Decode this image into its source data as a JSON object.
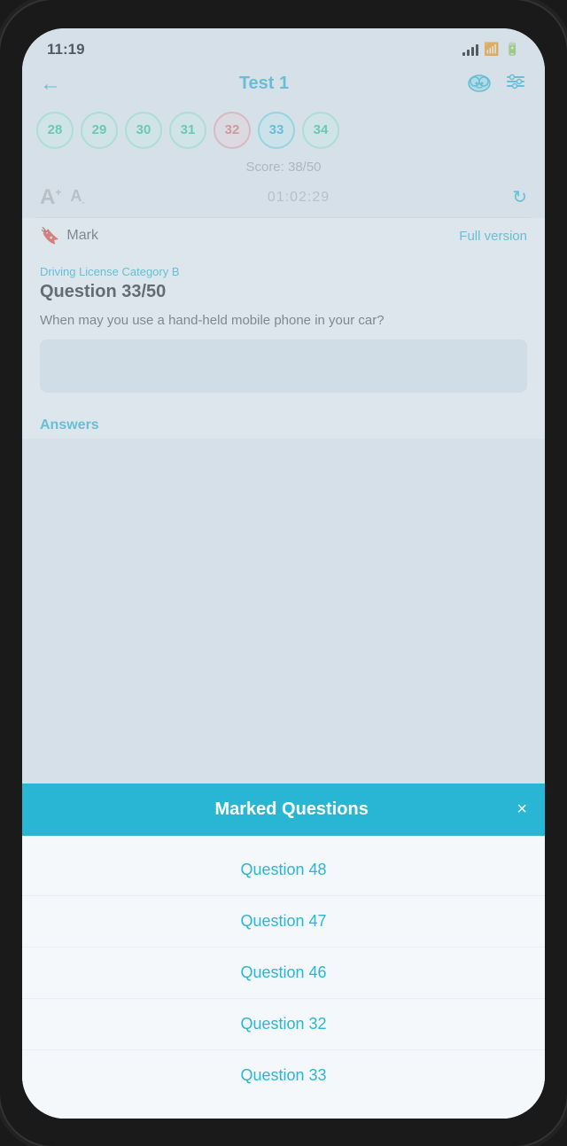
{
  "statusBar": {
    "time": "11:19",
    "lockIcon": "🔒"
  },
  "header": {
    "backLabel": "←",
    "title": "Test 1",
    "cloudIcon": "☁",
    "filterIcon": "⚙"
  },
  "questionNumbers": [
    {
      "num": "28",
      "state": "correct"
    },
    {
      "num": "29",
      "state": "correct"
    },
    {
      "num": "30",
      "state": "correct"
    },
    {
      "num": "31",
      "state": "correct"
    },
    {
      "num": "32",
      "state": "wrong"
    },
    {
      "num": "33",
      "state": "current"
    },
    {
      "num": "34",
      "state": "correct"
    }
  ],
  "score": "Score: 38/50",
  "timer": "01:02:29",
  "mark": {
    "label": "Mark",
    "fullVersionLabel": "Full version"
  },
  "question": {
    "category": "Driving License Category B",
    "number": "Question 33/50",
    "text": "When may you use a hand-held mobile phone in your car?"
  },
  "answersLabel": "Answers",
  "modal": {
    "title": "Marked Questions",
    "closeIcon": "×",
    "items": [
      {
        "label": "Question 48"
      },
      {
        "label": "Question 47"
      },
      {
        "label": "Question 46"
      },
      {
        "label": "Question 32"
      },
      {
        "label": "Question 33"
      }
    ]
  }
}
